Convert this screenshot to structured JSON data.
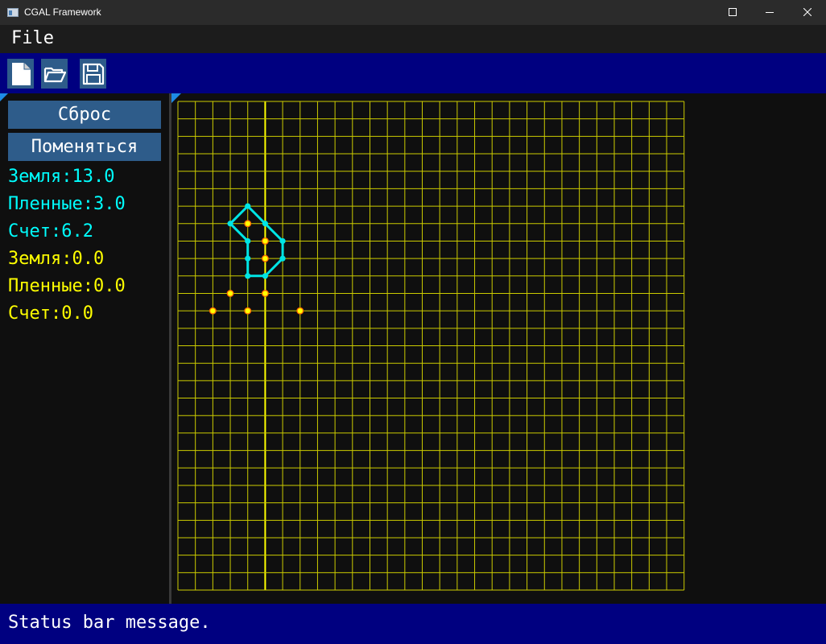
{
  "window": {
    "title": "CGAL Framework",
    "controls": [
      "minimize-icon",
      "maximize-icon",
      "close-icon"
    ]
  },
  "menu": {
    "items": [
      {
        "label": "File"
      }
    ]
  },
  "toolbar": {
    "buttons": [
      {
        "name": "new-file",
        "icon": "new-file-icon"
      },
      {
        "name": "open-folder",
        "icon": "folder-open-icon"
      },
      {
        "name": "save",
        "icon": "save-icon"
      }
    ]
  },
  "sidebar": {
    "reset_label": "Сброс",
    "swap_label": "Поменяться",
    "player1": {
      "color": "#00ffff",
      "land": "Земля:13.0",
      "captives": "Пленные:3.0",
      "score": "Счет:6.2"
    },
    "player2": {
      "color": "#ffff00",
      "land": "Земля:0.0",
      "captives": "Пленные:0.0",
      "score": "Счет:0.0"
    }
  },
  "board": {
    "columns": 29,
    "rows": 28,
    "grid_color": "#cccc00",
    "axis_color": "#ffff00",
    "axis_column": 5,
    "cyan_color": "#00e5e5",
    "yellow_color": "#ffff00",
    "yellow_stone_outline": "#ff6600",
    "cyan_polygon": [
      [
        4,
        6
      ],
      [
        3,
        7
      ],
      [
        4,
        8
      ],
      [
        4,
        10
      ],
      [
        5,
        10
      ],
      [
        6,
        9
      ],
      [
        6,
        8
      ],
      [
        5,
        7
      ]
    ],
    "cyan_points": [
      [
        4,
        6
      ],
      [
        3,
        7
      ],
      [
        5,
        7
      ],
      [
        4,
        8
      ],
      [
        6,
        8
      ],
      [
        4,
        9
      ],
      [
        6,
        9
      ],
      [
        4,
        10
      ],
      [
        5,
        10
      ]
    ],
    "yellow_points": [
      [
        4,
        7
      ],
      [
        5,
        8
      ],
      [
        5,
        9
      ],
      [
        3,
        11
      ],
      [
        5,
        11
      ],
      [
        2,
        12
      ],
      [
        4,
        12
      ],
      [
        7,
        12
      ]
    ]
  },
  "status": {
    "message": "Status bar message."
  }
}
